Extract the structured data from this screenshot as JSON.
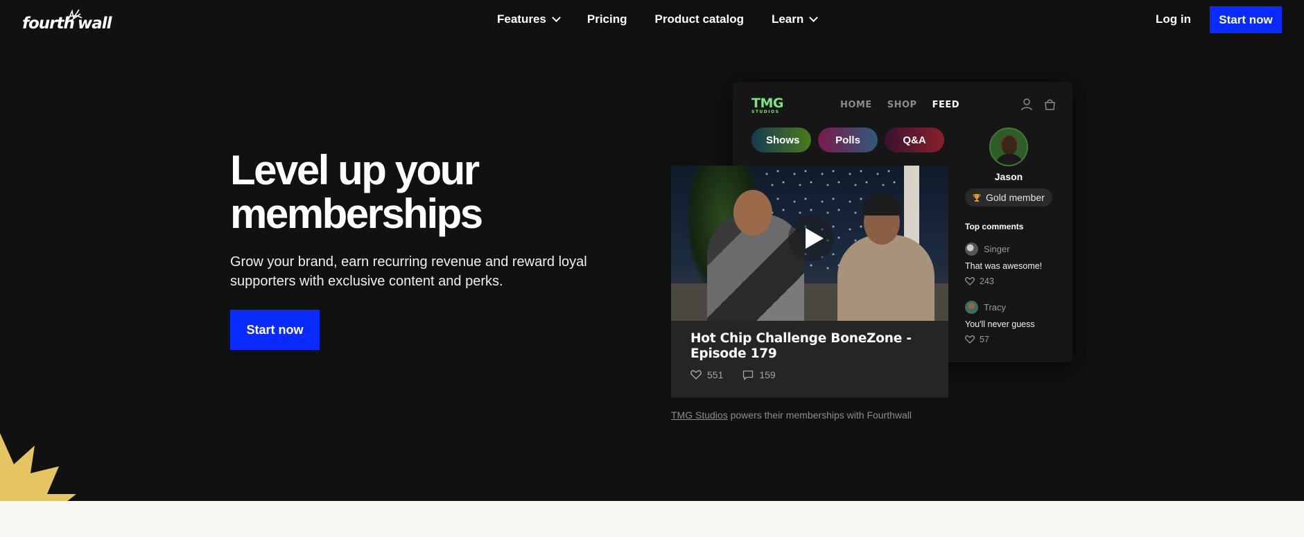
{
  "colors": {
    "accent": "#0a2bff",
    "background": "#111111",
    "brand_green": "#7de37c",
    "starburst": "#e5c463",
    "lower_section": "#f8f7f2"
  },
  "logo": {
    "left": "fourth",
    "right": "wall"
  },
  "nav": {
    "items": [
      {
        "label": "Features",
        "has_dropdown": true
      },
      {
        "label": "Pricing",
        "has_dropdown": false
      },
      {
        "label": "Product catalog",
        "has_dropdown": false
      },
      {
        "label": "Learn",
        "has_dropdown": true
      }
    ],
    "login": "Log in",
    "cta": "Start now"
  },
  "hero": {
    "title": "Level up your memberships",
    "subtitle": "Grow your brand, earn recurring revenue and reward loyal supporters with exclusive content and perks.",
    "cta": "Start now"
  },
  "store": {
    "logo": "TMG",
    "logo_sub": "STUDIOS",
    "nav": [
      "HOME",
      "SHOP",
      "FEED"
    ],
    "active_nav": "FEED",
    "pills": [
      "Shows",
      "Polls",
      "Q&A"
    ],
    "profile": {
      "name": "Jason",
      "badge": "Gold member",
      "badge_icon": "trophy-icon"
    },
    "top_comments_label": "Top comments",
    "comments": [
      {
        "user": "Singer",
        "text": "That was awesome!",
        "likes": "243"
      },
      {
        "user": "Tracy",
        "text": "You'll never guess",
        "likes": "57"
      }
    ]
  },
  "video": {
    "title": "Hot Chip Challenge BoneZone - Episode 179",
    "likes": "551",
    "comments": "159"
  },
  "caption": {
    "link": "TMG Studios",
    "rest": "powers their memberships with Fourthwall"
  }
}
